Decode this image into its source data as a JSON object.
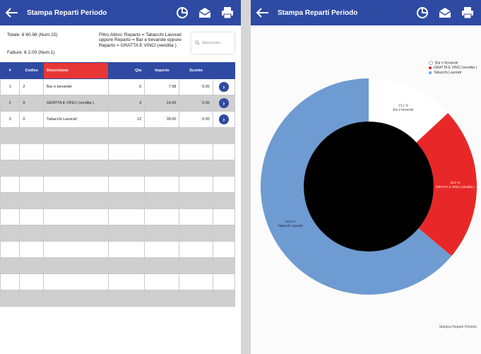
{
  "app": {
    "title": "Stampa Reparti Periodo"
  },
  "left": {
    "totale": "Totale: € 60.98 (Num.15)",
    "fatture": "Fatture: € 2.00 (Num.1)",
    "filtro": "Filtro Attivo: Reparto = Tabacchi Lavorati oppure Reparto = Bar e bevande oppure Reparto = GRATTA E VINCI (vendita )",
    "search_placeholder": "descrizione..",
    "headers": [
      "#",
      "Codice",
      "Descrizione",
      "Qta",
      "Importo",
      "Sconto"
    ],
    "rows": [
      {
        "idx": "1",
        "codice": "2",
        "descrizione": "Bar e bevande",
        "qta": "5",
        "importo": "7.98",
        "sconto": "0.00"
      },
      {
        "idx": "2",
        "codice": "9",
        "descrizione": "GRATTA E VINCI (vendita )",
        "qta": "3",
        "importo": "14.00",
        "sconto": "0.00"
      },
      {
        "idx": "3",
        "codice": "0",
        "descrizione": "Tabacchi Lavorati",
        "qta": "12",
        "importo": "39.00",
        "sconto": "0.00"
      }
    ]
  },
  "right": {
    "footer": "Stampa Reparti Periodo"
  },
  "chart_data": {
    "type": "pie",
    "labels": [
      "Bar e bevande",
      "GRATTA E VINCI (vendita )",
      "Tabacchi Lavorati"
    ],
    "values": [
      13.1,
      23.0,
      63.9
    ],
    "value_labels": [
      "13.1 %",
      "23.0 %",
      "63.9 %"
    ],
    "colors": [
      "#ffffff",
      "#e82828",
      "#6e9bd1"
    ],
    "legend": "top-right",
    "title": ""
  },
  "colors": {
    "primary": "#2e4aa3",
    "accent": "#e83636"
  }
}
